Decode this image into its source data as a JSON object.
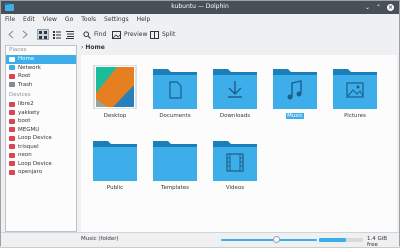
{
  "window": {
    "title": "kubuntu — Dolphin"
  },
  "menubar": {
    "items": [
      "File",
      "Edit",
      "View",
      "Go",
      "Tools",
      "Settings",
      "Help"
    ]
  },
  "toolbar": {
    "find_label": "Find",
    "preview_label": "Preview",
    "split_label": "Split"
  },
  "places": {
    "places_title": "Places",
    "places_items": [
      "Home",
      "Network",
      "Root",
      "Trash"
    ],
    "devices_title": "Devices",
    "devices_items": [
      "libre2",
      "yakkety",
      "boot",
      "MEGMU",
      "Loop Device",
      "trisquel",
      "neon",
      "Loop Device",
      "openjaro"
    ]
  },
  "breadcrumb": {
    "arrow": "›",
    "current": "Home"
  },
  "files": [
    {
      "name": "Desktop"
    },
    {
      "name": "Documents"
    },
    {
      "name": "Downloads"
    },
    {
      "name": "Music",
      "selected": true
    },
    {
      "name": "Pictures"
    },
    {
      "name": "Public"
    },
    {
      "name": "Templates"
    },
    {
      "name": "Videos"
    }
  ],
  "status": {
    "text": "Music (folder)",
    "free_space": "1.4 GiB free",
    "zoom_fraction": 0.58,
    "used_fraction": 0.62
  },
  "colors": {
    "folder": "#3daee9",
    "folder_dark": "#1d7fb8",
    "selection": "#3daee9",
    "titlebar": "#475057"
  }
}
